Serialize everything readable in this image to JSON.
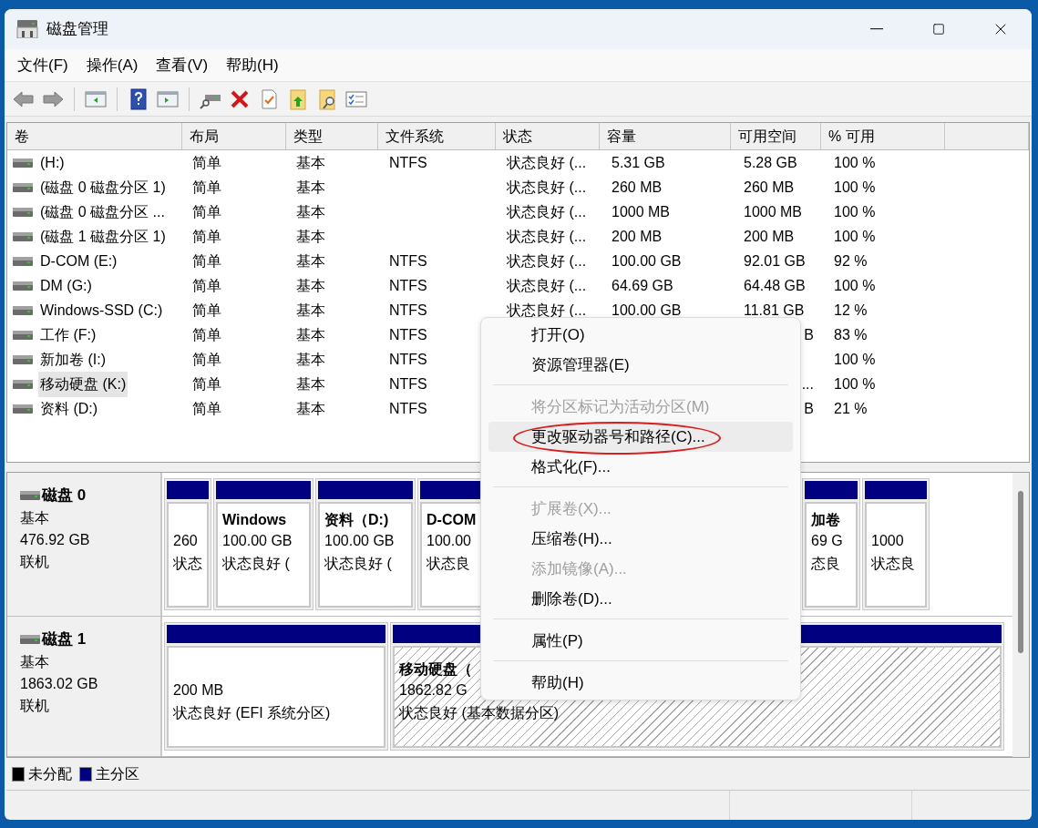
{
  "window": {
    "title": "磁盘管理"
  },
  "menu_bar": [
    "文件(F)",
    "操作(A)",
    "查看(V)",
    "帮助(H)"
  ],
  "volume_table": {
    "columns": [
      "卷",
      "布局",
      "类型",
      "文件系统",
      "状态",
      "容量",
      "可用空间",
      "% 可用"
    ],
    "rows": [
      {
        "volume": "(H:)",
        "layout": "简单",
        "type": "基本",
        "file_system": "NTFS",
        "status": "状态良好 (...",
        "capacity": "5.31 GB",
        "free_space": "5.28 GB",
        "percent_free": "100 %",
        "selected": false
      },
      {
        "volume": "(磁盘 0 磁盘分区 1)",
        "layout": "简单",
        "type": "基本",
        "status": "状态良好 (...",
        "capacity": "260 MB",
        "free_space": "260 MB",
        "percent_free": "100 %",
        "selected": false
      },
      {
        "volume": "(磁盘 0 磁盘分区 ...",
        "layout": "简单",
        "type": "基本",
        "status": "状态良好 (...",
        "capacity": "1000 MB",
        "free_space": "1000 MB",
        "percent_free": "100 %",
        "selected": false
      },
      {
        "volume": "(磁盘 1 磁盘分区 1)",
        "layout": "简单",
        "type": "基本",
        "status": "状态良好 (...",
        "capacity": "200 MB",
        "free_space": "200 MB",
        "percent_free": "100 %",
        "selected": false
      },
      {
        "volume": "D-COM (E:)",
        "layout": "简单",
        "type": "基本",
        "file_system": "NTFS",
        "status": "状态良好 (...",
        "capacity": "100.00 GB",
        "free_space": "92.01 GB",
        "percent_free": "92 %",
        "selected": false
      },
      {
        "volume": "DM (G:)",
        "layout": "简单",
        "type": "基本",
        "file_system": "NTFS",
        "status": "状态良好 (...",
        "capacity": "64.69 GB",
        "free_space": "64.48 GB",
        "percent_free": "100 %",
        "selected": false
      },
      {
        "volume": "Windows-SSD (C:)",
        "layout": "简单",
        "type": "基本",
        "file_system": "NTFS",
        "status": "状态良好 (...",
        "capacity": "100.00 GB",
        "free_space": "11.81 GB",
        "percent_free": "12 %",
        "selected": false
      },
      {
        "volume": "工作 (F:)",
        "layout": "简单",
        "type": "基本",
        "file_system": "NTFS",
        "free_space": "B",
        "free_clipped": true,
        "percent_free": "83 %",
        "selected": false
      },
      {
        "volume": "新加卷 (I:)",
        "layout": "简单",
        "type": "基本",
        "file_system": "NTFS",
        "percent_free": "100 %",
        "selected": false
      },
      {
        "volume": "移动硬盘 (K:)",
        "layout": "简单",
        "type": "基本",
        "file_system": "NTFS",
        "free_space": "...",
        "free_clipped": true,
        "percent_free": "100 %",
        "selected": true
      },
      {
        "volume": "资料 (D:)",
        "layout": "简单",
        "type": "基本",
        "file_system": "NTFS",
        "free_space": "B",
        "free_clipped": true,
        "percent_free": "21 %",
        "selected": false
      }
    ]
  },
  "disks": [
    {
      "name": "磁盘 0",
      "type": "基本",
      "size": "476.92 GB",
      "status": "联机",
      "partitions": [
        {
          "lines": [
            "260",
            "状态"
          ],
          "selected": false
        },
        {
          "title": "Windows",
          "lines": [
            "100.00 GB",
            "状态良好 ("
          ],
          "selected": false
        },
        {
          "title": "资料（D:)",
          "lines": [
            "100.00 GB",
            "状态良好 ("
          ],
          "selected": false
        },
        {
          "title": "D-COM",
          "lines": [
            "100.00",
            "状态良"
          ],
          "selected": false
        },
        {
          "title": "加卷",
          "lines": [
            "69 G",
            "态良"
          ],
          "selected": false
        },
        {
          "lines": [
            "1000",
            "状态良"
          ],
          "selected": false
        }
      ]
    },
    {
      "name": "磁盘 1",
      "type": "基本",
      "size": "1863.02 GB",
      "status": "联机",
      "partitions": [
        {
          "lines": [
            "200 MB",
            "状态良好 (EFI 系统分区)"
          ],
          "selected": false
        },
        {
          "title": "移动硬盘（",
          "lines": [
            "1862.82 G",
            "状态良好 (基本数据分区)"
          ],
          "selected": true
        }
      ]
    }
  ],
  "legend": [
    {
      "label": "未分配",
      "color": "#000000"
    },
    {
      "label": "主分区",
      "color": "#000080"
    }
  ],
  "context_menu": [
    {
      "kind": "item",
      "label": "打开(O)",
      "disabled": false,
      "hovered": false,
      "circled": false
    },
    {
      "kind": "item",
      "label": "资源管理器(E)",
      "disabled": false,
      "hovered": false,
      "circled": false
    },
    {
      "kind": "separator"
    },
    {
      "kind": "item",
      "label": "将分区标记为活动分区(M)",
      "disabled": true,
      "hovered": false,
      "circled": false
    },
    {
      "kind": "item",
      "label": "更改驱动器号和路径(C)...",
      "disabled": false,
      "hovered": true,
      "circled": true
    },
    {
      "kind": "item",
      "label": "格式化(F)...",
      "disabled": false,
      "hovered": false,
      "circled": false
    },
    {
      "kind": "separator"
    },
    {
      "kind": "item",
      "label": "扩展卷(X)...",
      "disabled": true,
      "hovered": false,
      "circled": false
    },
    {
      "kind": "item",
      "label": "压缩卷(H)...",
      "disabled": false,
      "hovered": false,
      "circled": false
    },
    {
      "kind": "item",
      "label": "添加镜像(A)...",
      "disabled": true,
      "hovered": false,
      "circled": false
    },
    {
      "kind": "item",
      "label": "删除卷(D)...",
      "disabled": false,
      "hovered": false,
      "circled": false
    },
    {
      "kind": "separator"
    },
    {
      "kind": "item",
      "label": "属性(P)",
      "disabled": false,
      "hovered": false,
      "circled": false
    },
    {
      "kind": "separator"
    },
    {
      "kind": "item",
      "label": "帮助(H)",
      "disabled": false,
      "hovered": false,
      "circled": false
    }
  ]
}
